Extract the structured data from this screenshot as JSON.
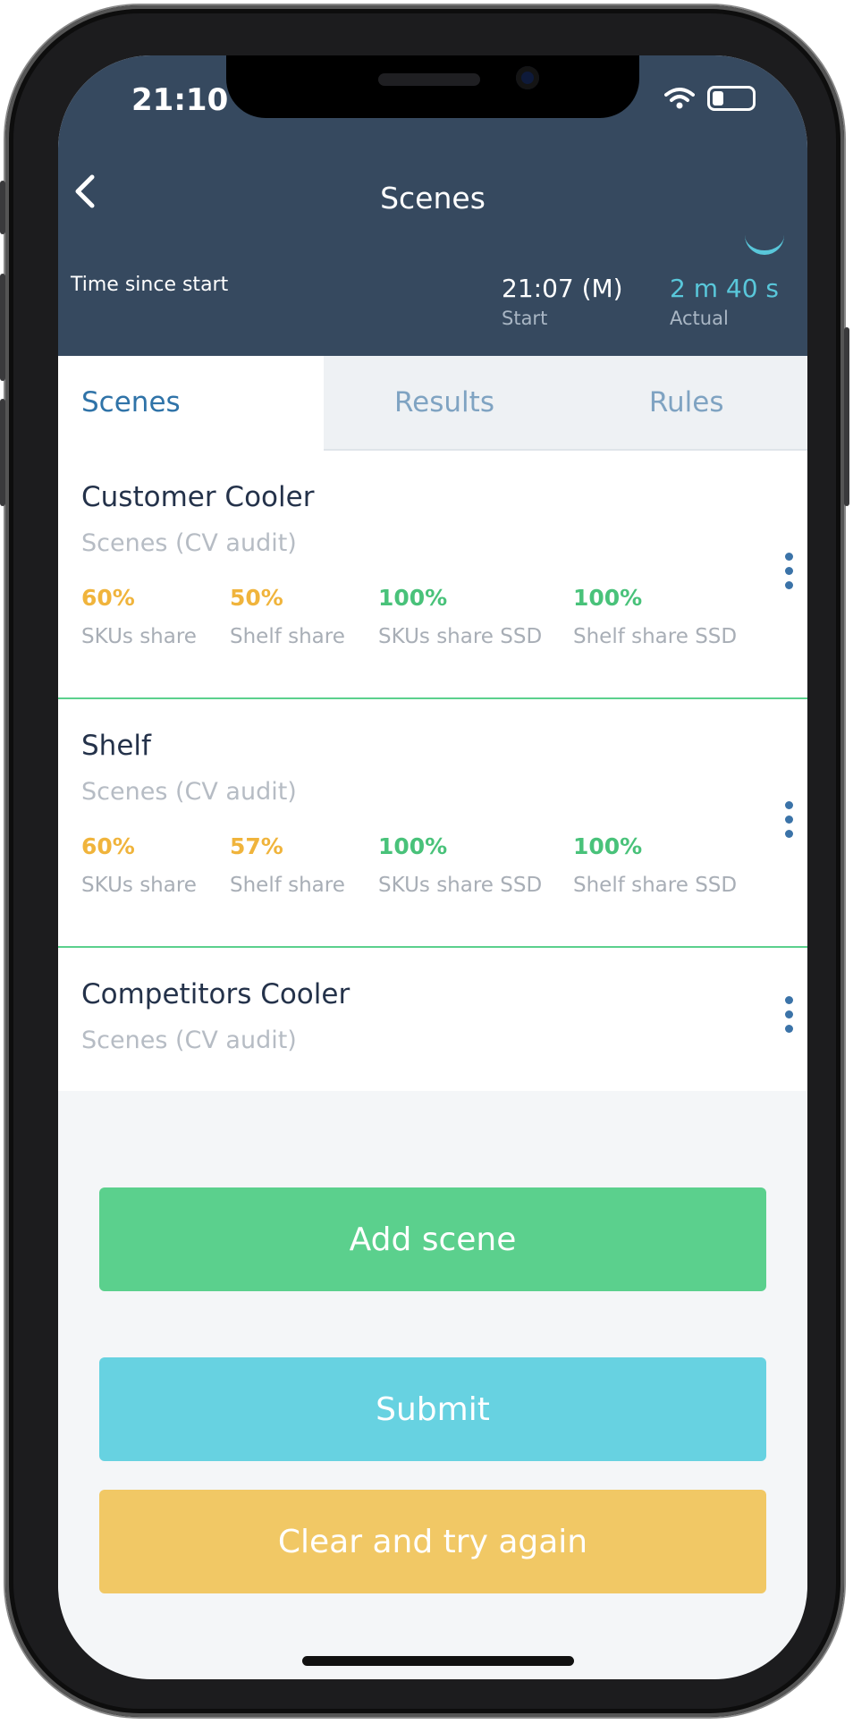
{
  "status_bar": {
    "time": "21:10"
  },
  "header": {
    "title": "Scenes",
    "time_since_start_label": "Time since start",
    "start_value": "21:07 (M)",
    "start_label": "Start",
    "actual_value": "2 m 40 s",
    "actual_label": "Actual"
  },
  "tabs": [
    {
      "label": "Scenes",
      "active": true
    },
    {
      "label": "Results",
      "active": false
    },
    {
      "label": "Rules",
      "active": false
    }
  ],
  "scenes": [
    {
      "title": "Customer Cooler",
      "subtitle": "Scenes (CV audit)",
      "metrics": [
        {
          "value": "60%",
          "label": "SKUs share",
          "color": "#f0b43c"
        },
        {
          "value": "50%",
          "label": "Shelf share",
          "color": "#f0b43c"
        },
        {
          "value": "100%",
          "label": "SKUs share SSD",
          "color": "#49c27a"
        },
        {
          "value": "100%",
          "label": "Shelf share SSD",
          "color": "#49c27a"
        }
      ]
    },
    {
      "title": "Shelf",
      "subtitle": "Scenes (CV audit)",
      "metrics": [
        {
          "value": "60%",
          "label": "SKUs share",
          "color": "#f0b43c"
        },
        {
          "value": "57%",
          "label": "Shelf share",
          "color": "#f0b43c"
        },
        {
          "value": "100%",
          "label": "SKUs share SSD",
          "color": "#49c27a"
        },
        {
          "value": "100%",
          "label": "Shelf share SSD",
          "color": "#49c27a"
        }
      ]
    },
    {
      "title": "Competitors Cooler",
      "subtitle": "Scenes (CV audit)",
      "metrics": []
    }
  ],
  "buttons": {
    "add_scene": {
      "label": "Add scene",
      "color": "#5bd08d"
    },
    "submit": {
      "label": "Submit",
      "color": "#67d2e1"
    },
    "clear": {
      "label": "Clear and try again",
      "color": "#f1c865"
    }
  },
  "icons": [
    "back-chevron-icon",
    "wifi-icon",
    "battery-icon",
    "kebab-menu-icon"
  ]
}
